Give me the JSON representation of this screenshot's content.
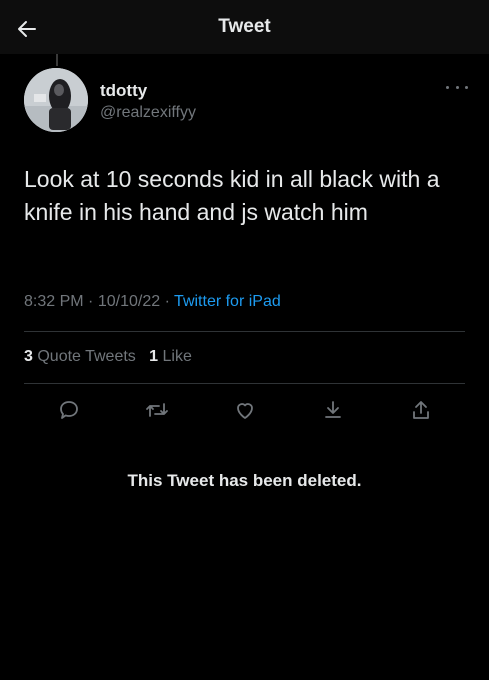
{
  "header": {
    "title": "Tweet",
    "back_icon": "arrow-left-icon"
  },
  "tweet": {
    "author_name": "tdotty",
    "author_handle": "@realzexiffyy",
    "text": "Look at 10 seconds kid in all black with a knife in his hand and js watch him",
    "time": "8:32 PM",
    "date": "10/10/22",
    "source": "Twitter for iPad",
    "separator": "·",
    "quote_count": "3",
    "quote_label": "Quote Tweets",
    "like_count": "1",
    "like_label": "Like"
  },
  "actions": [
    "reply-icon",
    "retweet-icon",
    "like-icon",
    "bookmark-icon",
    "share-icon"
  ],
  "quoted_tweet": {
    "status": "This Tweet has been deleted."
  },
  "colors": {
    "background": "#000000",
    "text": "#e7e9ea",
    "muted": "#71767b",
    "link": "#1d9bf0",
    "divider": "#2f3336"
  }
}
